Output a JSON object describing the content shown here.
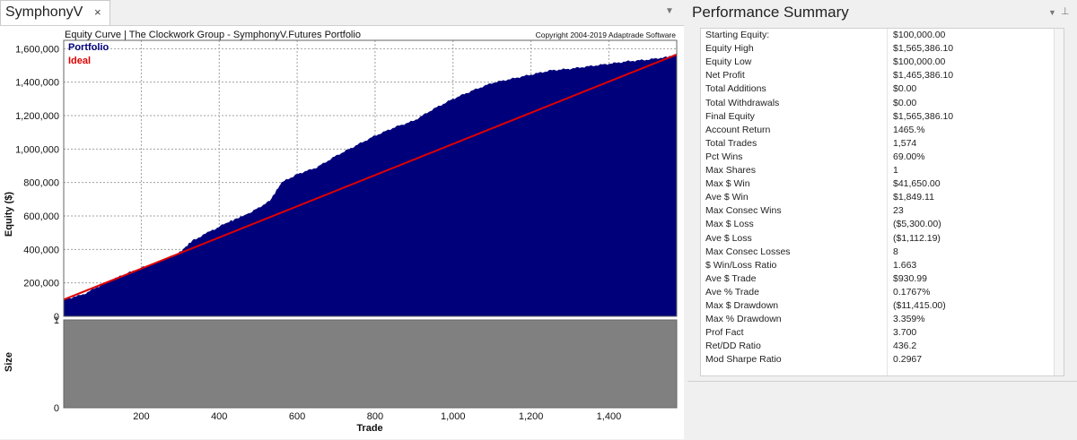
{
  "document_tab": {
    "title": "SymphonyV",
    "close_glyph": "×"
  },
  "tab_dropdown_glyph": "▼",
  "panel": {
    "title": "Performance Summary",
    "dropdown_glyph": "▼",
    "pin_glyph": "⊥"
  },
  "chart": {
    "title": "Equity Curve | The Clockwork Group - SymphonyV.Futures Portfolio",
    "copyright": "Copyright 2004-2019 Adaptrade Software",
    "legend": [
      {
        "name": "Portfolio",
        "color": "#00007b"
      },
      {
        "name": "Ideal",
        "color": "#e00000"
      }
    ],
    "ylabel": "Equity ($)",
    "size_label": "Size",
    "xlabel": "Trade",
    "y_ticks": [
      "0",
      "200,000",
      "400,000",
      "600,000",
      "800,000",
      "1,000,000",
      "1,200,000",
      "1,400,000",
      "1,600,000"
    ],
    "x_ticks": [
      "200",
      "400",
      "600",
      "800",
      "1,000",
      "1,200",
      "1,400"
    ],
    "size_ticks": [
      "0",
      "1"
    ],
    "colors": {
      "equity_fill": "#00007b",
      "ideal_line": "#e00000",
      "size_fill": "#808080",
      "grid": "#a0a0a0"
    }
  },
  "chart_data": [
    {
      "type": "area",
      "title": "Equity Curve | The Clockwork Group - SymphonyV.Futures Portfolio",
      "xlabel": "Trade",
      "ylabel": "Equity ($)",
      "xlim": [
        1,
        1574
      ],
      "ylim": [
        0,
        1650000
      ],
      "grid": true,
      "legend_position": "top-left",
      "series": [
        {
          "name": "Portfolio",
          "x": [
            1,
            50,
            100,
            150,
            200,
            250,
            300,
            330,
            370,
            420,
            480,
            530,
            560,
            600,
            650,
            700,
            750,
            800,
            850,
            900,
            950,
            1000,
            1050,
            1100,
            1150,
            1200,
            1250,
            1300,
            1350,
            1400,
            1450,
            1500,
            1550,
            1574
          ],
          "values": [
            100000,
            130000,
            190000,
            245000,
            290000,
            330000,
            385000,
            450000,
            500000,
            560000,
            620000,
            690000,
            800000,
            850000,
            890000,
            960000,
            1020000,
            1080000,
            1130000,
            1170000,
            1240000,
            1300000,
            1350000,
            1395000,
            1420000,
            1445000,
            1470000,
            1480000,
            1495000,
            1510000,
            1525000,
            1535000,
            1550000,
            1565386
          ]
        },
        {
          "name": "Ideal",
          "x": [
            1,
            1574
          ],
          "values": [
            100000,
            1565386
          ]
        }
      ]
    },
    {
      "type": "area",
      "ylabel": "Size",
      "xlabel": "Trade",
      "xlim": [
        1,
        1574
      ],
      "ylim": [
        0,
        1
      ],
      "series": [
        {
          "x": [
            1,
            1574
          ],
          "values": [
            1,
            1
          ]
        }
      ]
    }
  ],
  "summary": [
    {
      "label": "Starting Equity:",
      "value": "$100,000.00"
    },
    {
      "label": "Equity High",
      "value": "$1,565,386.10"
    },
    {
      "label": "Equity Low",
      "value": "$100,000.00"
    },
    {
      "label": "Net Profit",
      "value": "$1,465,386.10"
    },
    {
      "label": "Total Additions",
      "value": "$0.00"
    },
    {
      "label": "Total Withdrawals",
      "value": "$0.00"
    },
    {
      "label": "Final Equity",
      "value": "$1,565,386.10"
    },
    {
      "label": "Account Return",
      "value": "1465.%"
    },
    {
      "label": "Total Trades",
      "value": "1,574"
    },
    {
      "label": "Pct Wins",
      "value": "69.00%"
    },
    {
      "label": "Max Shares",
      "value": "1"
    },
    {
      "label": "Max $ Win",
      "value": "$41,650.00"
    },
    {
      "label": "Ave $ Win",
      "value": "$1,849.11"
    },
    {
      "label": "Max Consec Wins",
      "value": "23"
    },
    {
      "label": "Max $ Loss",
      "value": "($5,300.00)"
    },
    {
      "label": "Ave $ Loss",
      "value": "($1,112.19)"
    },
    {
      "label": "Max Consec Losses",
      "value": "8"
    },
    {
      "label": "$ Win/Loss Ratio",
      "value": "1.663"
    },
    {
      "label": "Ave $ Trade",
      "value": "$930.99"
    },
    {
      "label": "Ave % Trade",
      "value": "0.1767%"
    },
    {
      "label": "Max $ Drawdown",
      "value": "($11,415.00)"
    },
    {
      "label": "Max % Drawdown",
      "value": "3.359%"
    },
    {
      "label": "Prof Fact",
      "value": "3.700"
    },
    {
      "label": "Ret/DD Ratio",
      "value": "436.2"
    },
    {
      "label": "Mod Sharpe Ratio",
      "value": "0.2967"
    }
  ]
}
